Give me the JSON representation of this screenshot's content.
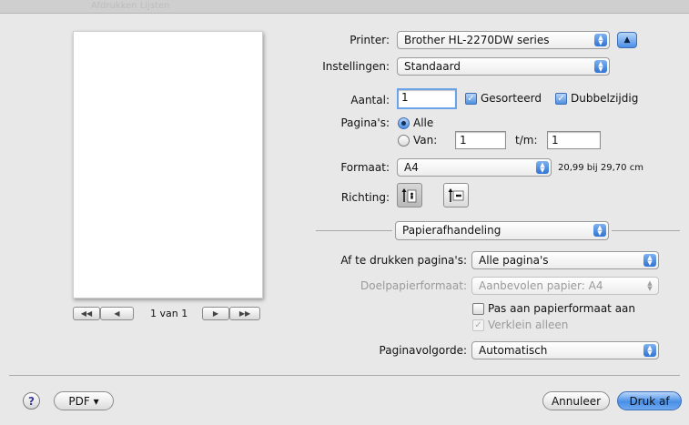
{
  "window": {
    "ghost_toolbar": "Afdrukken    Lijsten"
  },
  "preview": {
    "page_indicator": "1 van 1",
    "first_label": "◀◀",
    "prev_label": "◀",
    "next_label": "▶",
    "last_label": "▶▶"
  },
  "printer": {
    "label": "Printer:",
    "value": "Brother HL-2270DW series"
  },
  "presets": {
    "label": "Instellingen:",
    "value": "Standaard"
  },
  "copies": {
    "label": "Aantal:",
    "value": "1",
    "collated_label": "Gesorteerd",
    "collated_checked": true,
    "two_sided_label": "Dubbelzijdig",
    "two_sided_checked": true
  },
  "pages": {
    "label": "Pagina's:",
    "all_label": "Alle",
    "from_label": "Van:",
    "from_value": "1",
    "to_label": "t/m:",
    "to_value": "1",
    "selected": "all"
  },
  "paper_size": {
    "label": "Formaat:",
    "value": "A4",
    "dimensions": "20,99 bij 29,70 cm"
  },
  "orientation": {
    "label": "Richting:",
    "selected": "portrait"
  },
  "section": {
    "value": "Papierafhandeling"
  },
  "paper_handling": {
    "pages_to_print_label": "Af te drukken pagina's:",
    "pages_to_print_value": "Alle pagina's",
    "dest_paper_label": "Doelpapierformaat:",
    "dest_paper_value": "Aanbevolen papier: A4",
    "scale_to_fit_label": "Pas aan papierformaat aan",
    "scale_down_label": "Verklein alleen",
    "page_order_label": "Paginavolgorde:",
    "page_order_value": "Automatisch"
  },
  "footer": {
    "help_label": "?",
    "pdf_label": "PDF ▾",
    "cancel_label": "Annuleer",
    "print_label": "Druk af"
  },
  "colors": {
    "accent": "#4a8fe6",
    "background": "#e8e8e8"
  }
}
